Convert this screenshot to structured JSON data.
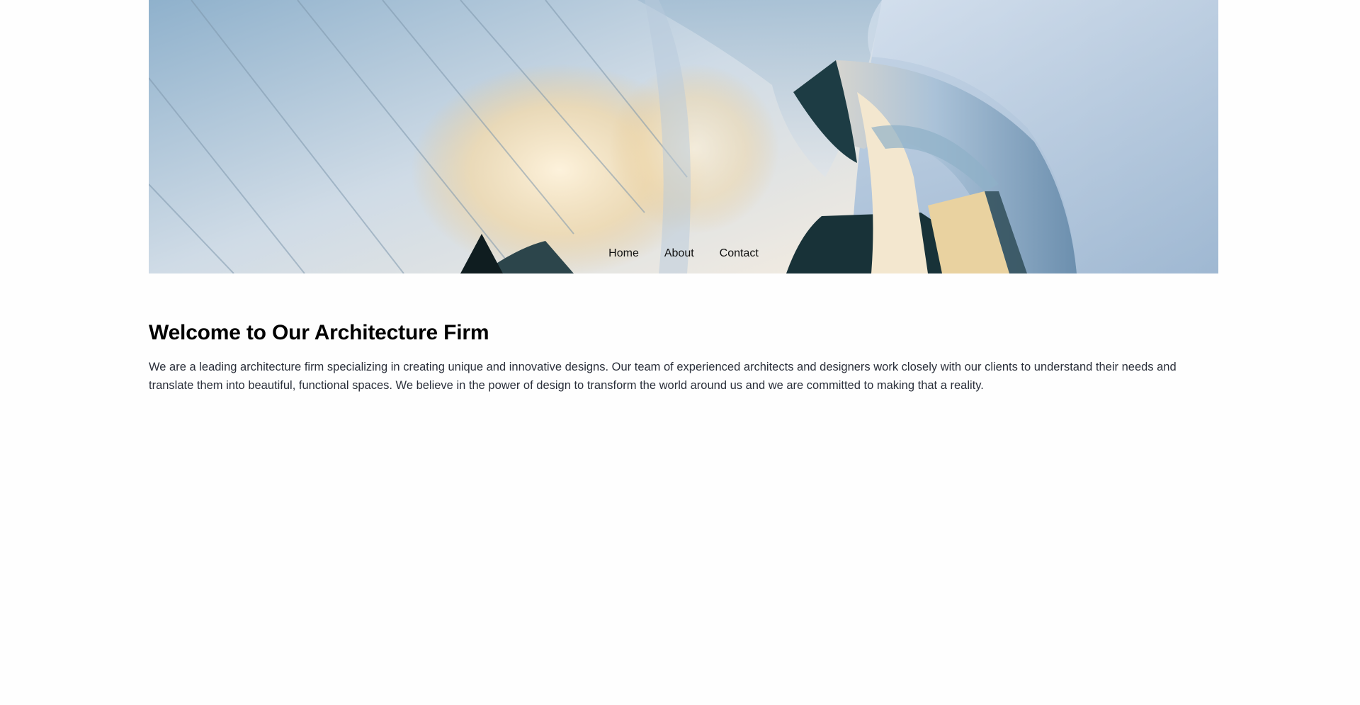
{
  "hero": {
    "image": "architecture-hero-image",
    "colors": {
      "sky": "#c3d3e6",
      "steel_light": "#dfe6ee",
      "steel_mid": "#a9bccd",
      "steel_dark": "#1f4048",
      "warm_glow": "#f2dcb0"
    }
  },
  "nav": {
    "items": [
      {
        "label": "Home"
      },
      {
        "label": "About"
      },
      {
        "label": "Contact"
      }
    ]
  },
  "main": {
    "heading": "Welcome to Our Architecture Firm",
    "paragraph": "We are a leading architecture firm specializing in creating unique and innovative designs. Our team of experienced architects and designers work closely with our clients to understand their needs and translate them into beautiful, functional spaces. We believe in the power of design to transform the world around us and we are committed to making that a reality."
  }
}
